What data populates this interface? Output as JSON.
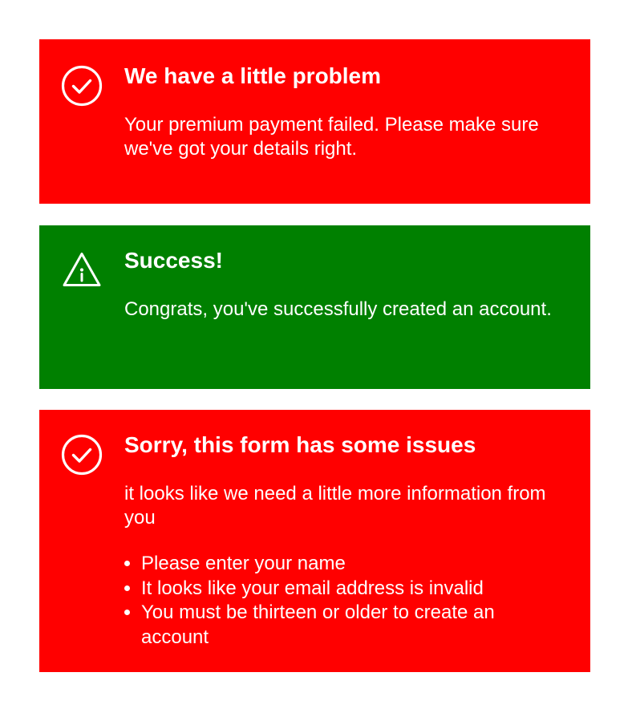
{
  "colors": {
    "error_background": "#ff0000",
    "success_background": "#008000",
    "text": "#ffffff"
  },
  "alerts": [
    {
      "type": "error",
      "icon": "check-circle-icon",
      "title": "We have a little problem",
      "message": "Your premium payment failed. Please make sure we've got your details right."
    },
    {
      "type": "success",
      "icon": "warning-triangle-icon",
      "title": "Success!",
      "message": "Congrats, you've successfully created an account."
    },
    {
      "type": "error",
      "icon": "check-circle-icon",
      "title": "Sorry, this form has some issues",
      "message": "it looks like we need a little more information from you",
      "issues": [
        "Please enter your name",
        "It looks like your email address is invalid",
        "You must be thirteen or older to create an account"
      ]
    }
  ]
}
